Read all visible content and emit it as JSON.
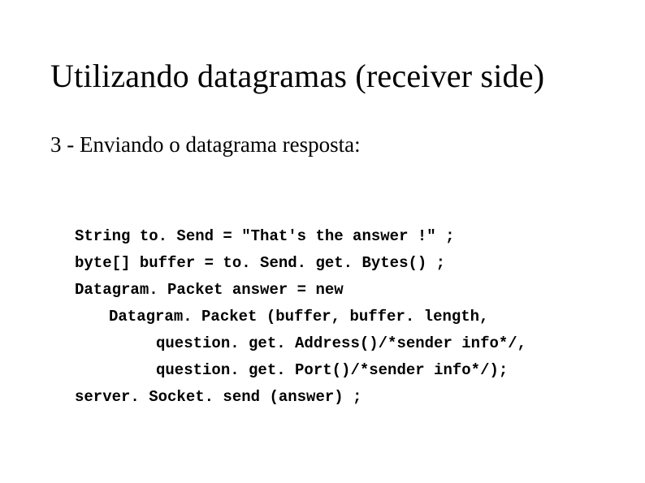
{
  "title": "Utilizando datagramas (receiver side)",
  "subtitle": "3 - Enviando o datagrama resposta:",
  "code": {
    "l1": "String to. Send = \"That's the answer !\" ;",
    "l2": "byte[] buffer = to. Send. get. Bytes() ;",
    "l3": "Datagram. Packet answer = new",
    "l4": "Datagram. Packet (buffer, buffer. length,",
    "l5": "question. get. Address()/*sender info*/,",
    "l6": "question. get. Port()/*sender info*/);",
    "l7": "server. Socket. send (answer) ;"
  }
}
